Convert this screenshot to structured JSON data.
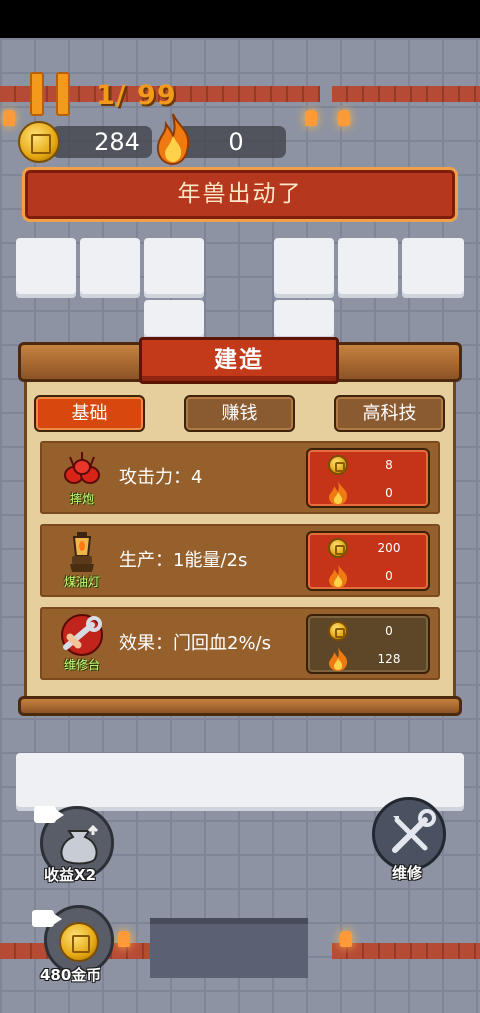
{
  "hud": {
    "wave": "1/ 99",
    "gold": "284",
    "energy": "0",
    "banner": "年兽出动了"
  },
  "build_panel": {
    "title": "建造",
    "tabs": [
      {
        "label": "基础",
        "active": true
      },
      {
        "label": "赚钱",
        "active": false
      },
      {
        "label": "高科技",
        "active": false
      }
    ],
    "items": [
      {
        "name": "摔炮",
        "desc": "攻击力：4",
        "gold_cost": "8",
        "energy_cost": "0",
        "affordable": true,
        "icon": "firecracker-icon"
      },
      {
        "name": "煤油灯",
        "desc": "生产：1能量/2s",
        "gold_cost": "200",
        "energy_cost": "0",
        "affordable": true,
        "icon": "oil-lamp-icon"
      },
      {
        "name": "维修台",
        "desc": "效果：门回血2%/s",
        "gold_cost": "0",
        "energy_cost": "128",
        "affordable": false,
        "icon": "repair-wrench-icon"
      }
    ]
  },
  "buttons": {
    "income_x2": "收益X2",
    "repair": "维修",
    "gold_reward": "480金币"
  },
  "colors": {
    "accent_orange": "#f39a1c",
    "banner_red": "#b5381e",
    "tab_active": "#d8470d",
    "cost_red": "#c53318"
  }
}
